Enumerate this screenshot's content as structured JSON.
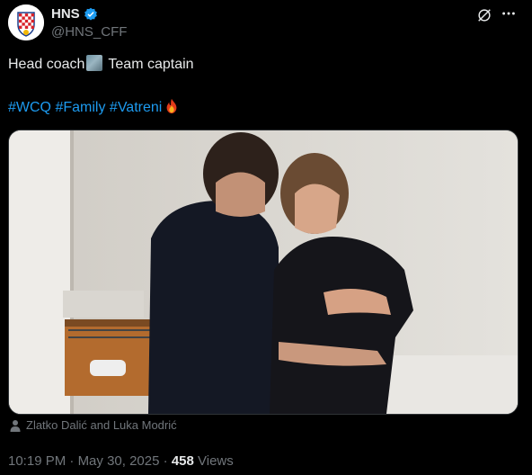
{
  "account": {
    "display_name": "HNS",
    "handle": "@HNS_CFF"
  },
  "tweet": {
    "text_before": "Head coach",
    "text_after": "Team captain",
    "hashtags": [
      "#WCQ",
      "#Family",
      "#Vatreni"
    ],
    "photo_caption": "Zlatko Dalić and Luka Modrić"
  },
  "meta": {
    "time": "10:19 PM",
    "date": "May 30, 2025",
    "views_count": "458",
    "views_label": "Views"
  },
  "colors": {
    "background": "#000000",
    "text": "#e7e9ea",
    "muted": "#71767b",
    "link": "#1d9bf0",
    "verified": "#1d9bf0"
  },
  "icons": [
    "hns-crest-avatar",
    "verified-badge-icon",
    "grok-icon",
    "more-icon",
    "person-icon",
    "fire-emoji-icon"
  ]
}
